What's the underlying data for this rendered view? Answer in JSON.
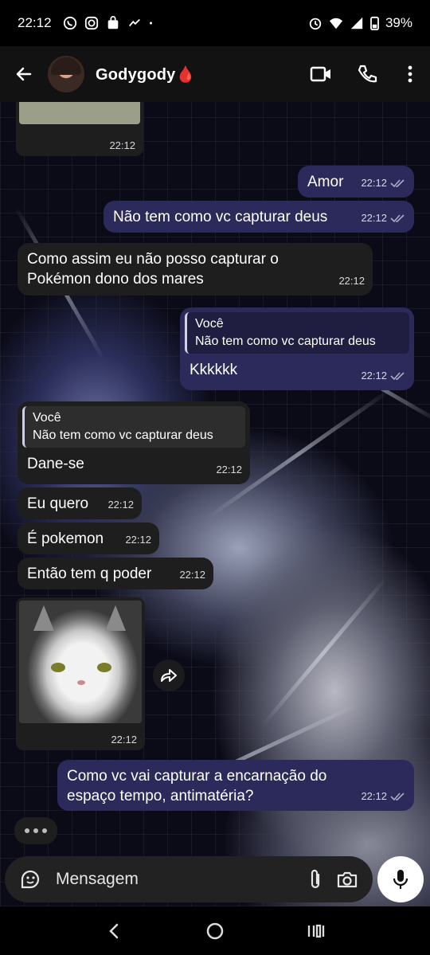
{
  "status_bar": {
    "time": "22:12",
    "battery": "39%",
    "left_icons": [
      "whatsapp-icon",
      "instagram-icon",
      "shopping-bag-icon",
      "recorder-icon",
      "dot-icon"
    ],
    "right_icons": [
      "alarm-icon",
      "wifi-icon",
      "signal-icon",
      "battery-icon"
    ]
  },
  "header": {
    "contact_name": "Godygody🩸",
    "icons": [
      "back-arrow-icon",
      "video-call-icon",
      "phone-call-icon",
      "more-vert-icon"
    ]
  },
  "messages": [
    {
      "id": "m0",
      "direction": "in",
      "type": "image-partial",
      "time": "22:12"
    },
    {
      "id": "m1",
      "direction": "out",
      "text": "Amor",
      "time": "22:12"
    },
    {
      "id": "m2",
      "direction": "out",
      "text": "Não tem como vc capturar deus",
      "time": "22:12"
    },
    {
      "id": "m3",
      "direction": "in",
      "text_line1": "Como assim eu não posso capturar o",
      "text_line2": "Pokémon dono dos mares",
      "time": "22:12"
    },
    {
      "id": "m4",
      "direction": "out",
      "quote_author": "Você",
      "quote_text": "Não tem como vc capturar deus",
      "text": "Kkkkkk",
      "time": "22:12"
    },
    {
      "id": "m5",
      "direction": "in",
      "quote_author": "Você",
      "quote_text": "Não tem como vc capturar deus",
      "text": "Dane-se",
      "time": "22:12"
    },
    {
      "id": "m6",
      "direction": "in",
      "text": "Eu quero",
      "time": "22:12"
    },
    {
      "id": "m7",
      "direction": "in",
      "text": "É pokemon",
      "time": "22:12"
    },
    {
      "id": "m8",
      "direction": "in",
      "text": "Então tem q poder",
      "time": "22:12"
    },
    {
      "id": "m9",
      "direction": "in",
      "type": "image",
      "time": "22:12"
    },
    {
      "id": "m10",
      "direction": "out",
      "text_line1": "Como vc vai capturar a encarnação do",
      "text_line2": "espaço tempo, antimatéria?",
      "time": "22:12"
    }
  ],
  "composer": {
    "placeholder": "Mensagem",
    "value": "",
    "icons": [
      "sticker-icon",
      "attach-icon",
      "camera-icon",
      "mic-icon"
    ]
  },
  "colors": {
    "outgoing_bubble": "#2c2a5a",
    "incoming_bubble": "#1e1e1e",
    "header": "#121212",
    "composer": "#222222"
  },
  "nav": [
    "nav-back-icon",
    "nav-home-icon",
    "nav-recents-icon"
  ]
}
